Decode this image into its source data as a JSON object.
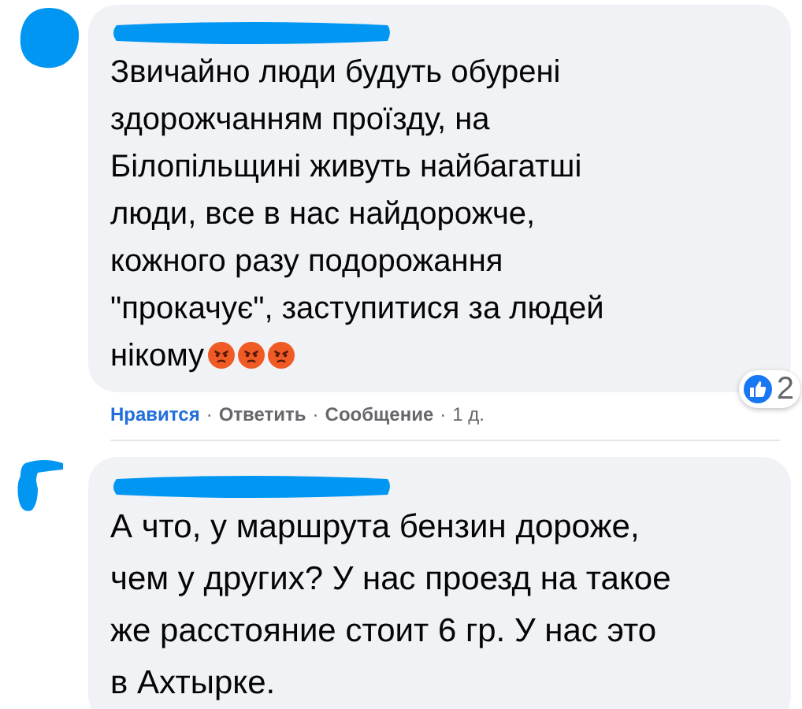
{
  "comments": [
    {
      "text": "Звичайно люди будуть обурені\nздорожчанням проїзду, на\nБілопільщині живуть найбагатші\nлюди, все в нас найдорожче,\nкожного разу подорожання\n\"прокачує\", заступитися за людей\nнікому",
      "actions": [
        {
          "label": "Нравится",
          "selected": true
        },
        {
          "label": "Ответить",
          "selected": false
        },
        {
          "label": "Сообщение",
          "selected": false
        }
      ],
      "separator": "·",
      "time": "1 д.",
      "reaction_count": "2"
    },
    {
      "text": "А что, у маршрута бензин дороже,\nчем у других? У нас проезд на такое\nже расстояние стоит 6 гр. У нас это\nв Ахтырке."
    }
  ]
}
